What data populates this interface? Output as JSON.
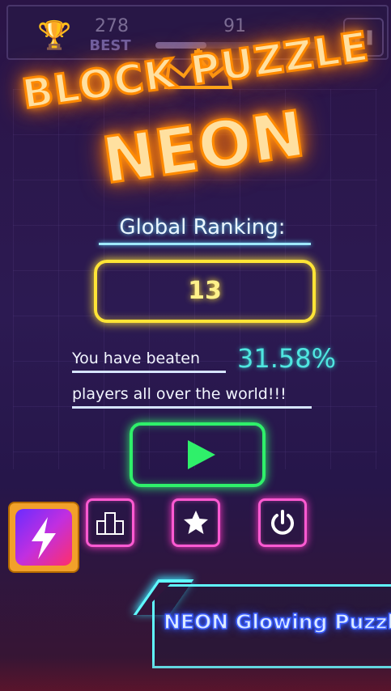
{
  "header": {
    "best_score": "278",
    "best_label": "BEST",
    "current_score": "91",
    "progress_fraction": 0.3
  },
  "title": {
    "line1": "BLOCK PUZZLE",
    "line2": "NEON"
  },
  "ranking": {
    "label": "Global Ranking:",
    "value": "13"
  },
  "stats": {
    "beaten_text": "You have beaten",
    "beaten_percent": "31.58%",
    "players_text": "players all over the world!!!"
  },
  "buttons": {
    "play_icon": "play-icon",
    "app_icon": "lightning-app-icon",
    "rank_icon": "podium-icon",
    "star_icon": "star-icon",
    "power_icon": "power-icon"
  },
  "banner": {
    "text": "NEON Glowing Puzzle"
  },
  "colors": {
    "title_glow": "#ff8a00",
    "rank_border": "#ffe436",
    "percent": "#4fe6e0",
    "play_border": "#2ff06a",
    "small_button_border": "#ff5ad2",
    "banner_border": "#5ff8ff"
  }
}
